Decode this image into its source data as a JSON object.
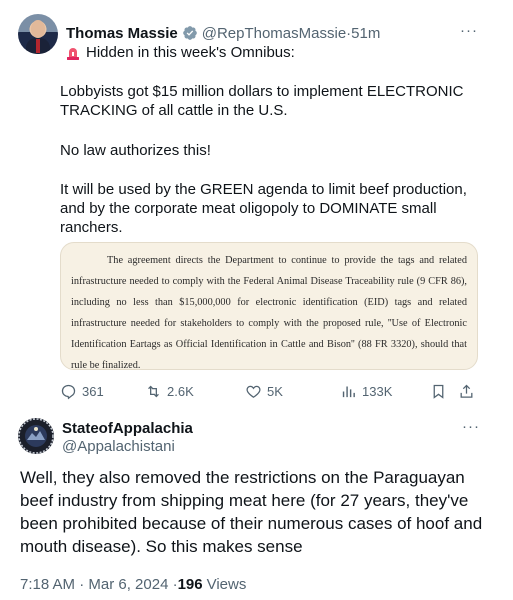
{
  "tweet": {
    "author_name": "Thomas Massie",
    "author_handle": "@RepThomasMassie",
    "time_sep": " · ",
    "time": "51m",
    "more": "···",
    "headline": "Hidden in this week's Omnibus:",
    "para1": "Lobbyists got $15 million dollars to implement ELECTRONIC TRACKING of all cattle in the U.S.",
    "para2": "No law authorizes this!",
    "para3": "It will be used by the GREEN agenda to limit beef production, and by the corporate meat oligopoly to DOMINATE small ranchers.",
    "document_text": "The agreement directs the Department to continue to provide the tags and related infrastructure needed to comply with the Federal Animal Disease Traceability rule (9 CFR 86), including no less than $15,000,000 for electronic identification (EID) tags and related infrastructure needed for stakeholders to comply with the proposed rule, ''Use of Electronic Identification Eartags as Official Identification in Cattle and Bison'' (88 FR 3320), should that rule be finalized.",
    "actions": {
      "replies": "361",
      "reposts": "2.6K",
      "likes": "5K",
      "views": "133K"
    }
  },
  "reply": {
    "author_name": "StateofAppalachia",
    "author_handle": "@Appalachistani",
    "more": "···",
    "text": "Well, they also removed the restrictions on the Paraguayan beef industry from shipping meat here (for 27 years, they've been prohibited because of their numerous cases of hoof and mouth disease). So this makes sense",
    "timestamp": "7:18 AM · Mar 6, 2024 · ",
    "view_count": "196",
    "views_label": "Views"
  },
  "colors": {
    "text": "#0f1419",
    "muted": "#536471",
    "verified_badge": "#829aab",
    "siren": "#e0245e",
    "document_bg": "#f7f1e4"
  },
  "icons": [
    "siren-icon",
    "verified-badge-icon",
    "reply-icon",
    "repost-icon",
    "like-icon",
    "views-icon",
    "bookmark-icon",
    "share-icon",
    "more-icon"
  ]
}
